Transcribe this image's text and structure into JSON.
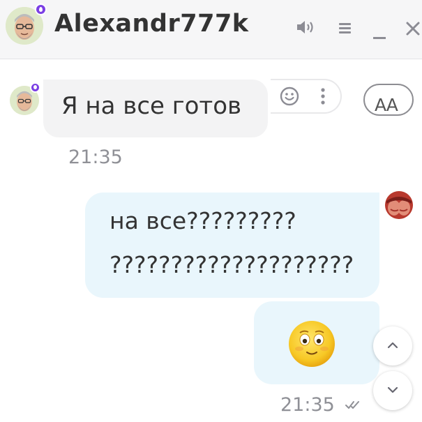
{
  "header": {
    "contact_name": "Alexandr777k",
    "icons": [
      "speaker-icon",
      "menu-icon",
      "minimize-icon",
      "close-icon"
    ]
  },
  "messages": {
    "incoming": {
      "text": "Я на все готов",
      "time": "21:35"
    },
    "outgoing": {
      "line1": "на все?????????",
      "line2": "????????????????????",
      "sticker": "smiling-emoji",
      "time": "21:35",
      "status": "read"
    }
  },
  "controls": {
    "font_size_label": "AA"
  },
  "colors": {
    "accent_badge": "#7b3fe4",
    "incoming_bubble": "#f3f3f4",
    "outgoing_bubble": "#e9f6fc",
    "text": "#333333",
    "timestamp": "#8f9096"
  }
}
